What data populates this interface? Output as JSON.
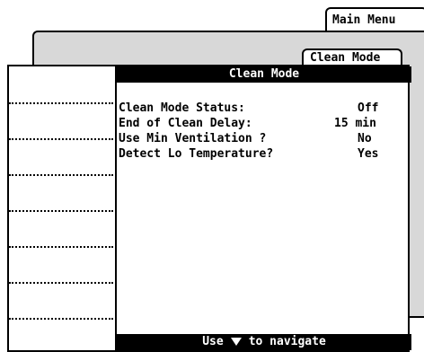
{
  "tabs": {
    "main_menu": "Main Menu",
    "clean_mode": "Clean Mode"
  },
  "screen": {
    "title": "Clean Mode",
    "rows": [
      {
        "label": "Clean Mode Status:",
        "value": "Off"
      },
      {
        "label": "End of Clean Delay:",
        "value": "15 min"
      },
      {
        "label": "Use Min Ventilation ?",
        "value": "No"
      },
      {
        "label": "Detect Lo Temperature?",
        "value": "Yes"
      }
    ],
    "footer": {
      "prefix": "Use",
      "icon": "down-arrow-icon",
      "suffix": "to navigate"
    }
  },
  "side_menu": {
    "slot_count": 7
  },
  "colors": {
    "background": "#ffffff",
    "back_panel": "#d8d8d8",
    "bar": "#000000",
    "bar_text": "#ffffff"
  }
}
